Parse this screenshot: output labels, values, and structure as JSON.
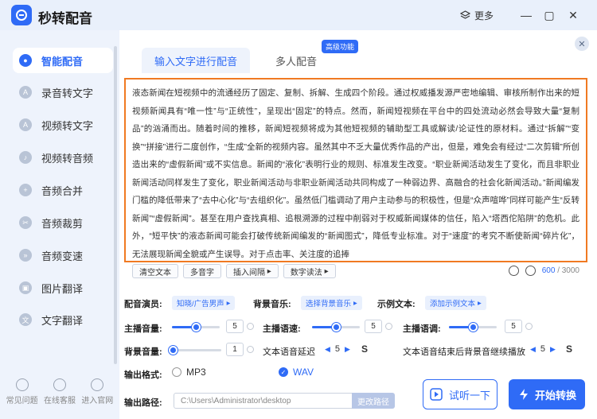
{
  "app": {
    "title": "秒转配音",
    "more": "更多"
  },
  "sidebar": {
    "items": [
      {
        "label": "智能配音",
        "icon": "mic-icon",
        "active": true
      },
      {
        "label": "录音转文字",
        "icon": "record-icon"
      },
      {
        "label": "视频转文字",
        "icon": "video-text-icon"
      },
      {
        "label": "视频转音频",
        "icon": "video-audio-icon"
      },
      {
        "label": "音频合并",
        "icon": "merge-icon"
      },
      {
        "label": "音频裁剪",
        "icon": "cut-icon"
      },
      {
        "label": "音频变速",
        "icon": "speed-icon"
      },
      {
        "label": "图片翻译",
        "icon": "image-translate-icon"
      },
      {
        "label": "文字翻译",
        "icon": "text-translate-icon"
      }
    ],
    "bottom": [
      {
        "label": "常见问题",
        "icon": "question-icon"
      },
      {
        "label": "在线客服",
        "icon": "chat-icon"
      },
      {
        "label": "进入官网",
        "icon": "home-icon"
      }
    ]
  },
  "tabs": [
    {
      "label": "输入文字进行配音",
      "active": true
    },
    {
      "label": "多人配音"
    }
  ],
  "badge": "高级功能",
  "editor": {
    "text": "液态新闻在短视频中的流通经历了固定、复制、拆解、生成四个阶段。通过权威播发源严密地编辑、审核所制作出来的短视频新闻具有“唯一性”与“正统性”，呈现出“固定”的特点。然而，新闻短视频在平台中的四处流动必然会导致大量“复制品”的汹涌而出。随着时间的推移，新闻短视频将成为其他短视频的辅助型工具或解读/论证性的原材料。通过“拆解”“变换”“拼接”进行二度创作，“生成”全新的视频内容。虽然其中不乏大量优秀作品的产出，但是，难免会有经过“二次剪辑”所创造出来的“虚假新闻”或不实信息。新闻的“液化”表明行业的规则、标准发生改变。“职业新闻活动发生了变化，而且非职业新闻活动同样发生了变化，职业新闻活动与非职业新闻活动共同构成了一种弱边界、高融合的社会化新闻活动。”新闻编发门槛的降低带来了“去中心化”与“去组织化”。虽然低门槛调动了用户主动参与的积极性，但是“众声喧哗”同样可能产生“反转新闻”“虚假新闻”。甚至在用户查找真相、追根溯源的过程中削弱对于权威新闻媒体的信任，陷入“塔西佗陷阱”的危机。此外，“短平快”的液态新闻可能会打破传统新闻编发的“新闻图式”，降低专业标准。对于“速度”的考究不断使新闻“碎片化”，无法展现新闻全貌或产生误导。对于点击率、关注度的追捧"
  },
  "tools": {
    "clear": "清空文本",
    "polyphone": "多音字",
    "pause": "插入间隔",
    "digits": "数字读法"
  },
  "counter": {
    "current": "600",
    "max": "/ 3000"
  },
  "settings": {
    "anchor_label": "配音演员:",
    "anchor_value": "知晓/广告男声",
    "bgm_label": "背景音乐:",
    "bgm_value": "选择背景音乐",
    "sample_label": "示例文本:",
    "sample_value": "添加示例文本",
    "volume_label": "主播音量:",
    "volume_value": "5",
    "speed_label": "主播语速:",
    "speed_value": "5",
    "pitch_label": "主播语调:",
    "pitch_value": "5",
    "bg_volume_label": "背景音量:",
    "bg_volume_value": "1",
    "delay_label": "文本语音延迟",
    "delay_value": "5",
    "delay_unit": "S",
    "continue_label": "文本语音结束后背景音继续播放",
    "continue_value": "5",
    "continue_unit": "S",
    "format_label": "输出格式:",
    "format_mp3": "MP3",
    "format_wav": "WAV",
    "path_label": "输出路径:",
    "path_value": "C:\\Users\\Administrator\\desktop",
    "path_button": "更改路径"
  },
  "actions": {
    "listen": "试听一下",
    "convert": "开始转换"
  }
}
